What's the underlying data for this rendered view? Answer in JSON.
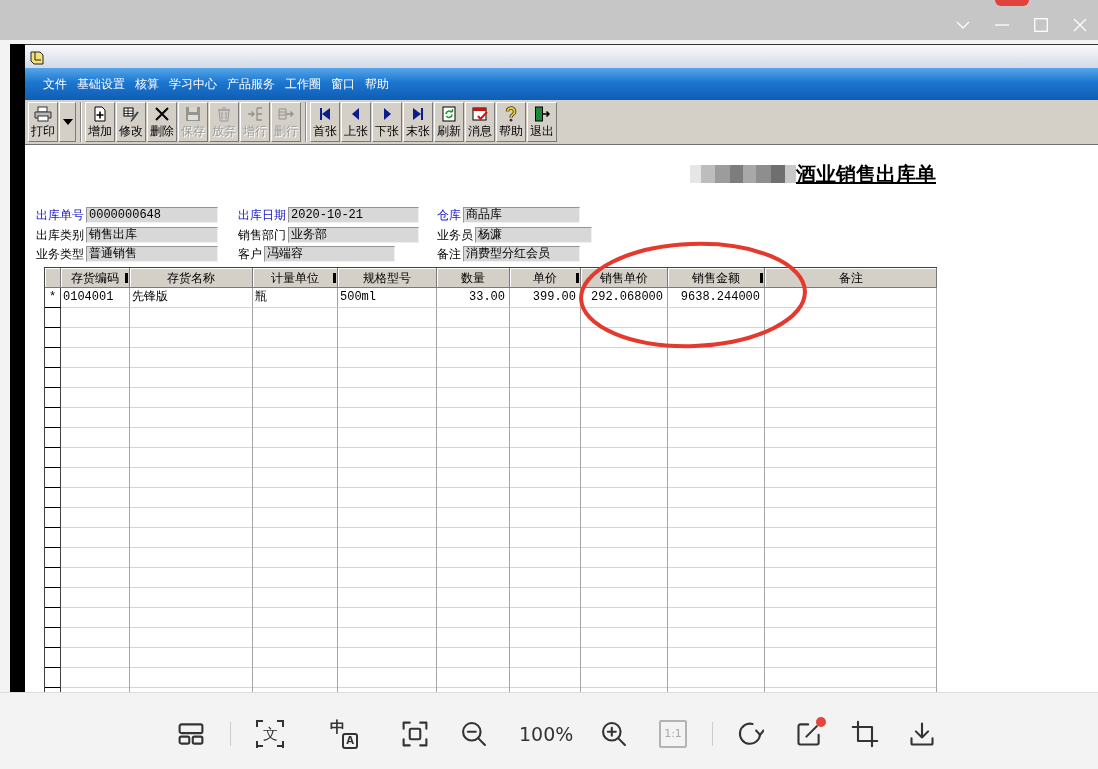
{
  "app": {
    "menu": [
      "文件",
      "基础设置",
      "核算",
      "学习中心",
      "产品服务",
      "工作圈",
      "窗口",
      "帮助"
    ],
    "toolbar": [
      [
        {
          "kind": "button",
          "label": "打印",
          "disabled": false
        },
        {
          "kind": "dropdown",
          "disabled": false
        }
      ],
      [
        {
          "kind": "button",
          "label": "增加",
          "disabled": false
        },
        {
          "kind": "button",
          "label": "修改",
          "disabled": false
        },
        {
          "kind": "button",
          "label": "删除",
          "disabled": false
        },
        {
          "kind": "button",
          "label": "保存",
          "disabled": true
        },
        {
          "kind": "button",
          "label": "放弃",
          "disabled": true
        },
        {
          "kind": "button",
          "label": "增行",
          "disabled": true
        },
        {
          "kind": "button",
          "label": "删行",
          "disabled": true
        }
      ],
      [
        {
          "kind": "button",
          "label": "首张",
          "disabled": false
        },
        {
          "kind": "button",
          "label": "上张",
          "disabled": false
        },
        {
          "kind": "button",
          "label": "下张",
          "disabled": false
        },
        {
          "kind": "button",
          "label": "末张",
          "disabled": false
        },
        {
          "kind": "button",
          "label": "刷新",
          "disabled": false
        },
        {
          "kind": "button",
          "label": "消息",
          "disabled": false
        },
        {
          "kind": "button",
          "label": "帮助",
          "disabled": false
        },
        {
          "kind": "button",
          "label": "退出",
          "disabled": false
        }
      ]
    ]
  },
  "form": {
    "title": "酒业销售出库单",
    "fields": [
      [
        {
          "label": "出库单号",
          "value": "0000000648",
          "required": true
        },
        {
          "label": "出库日期",
          "value": "2020-10-21",
          "required": true
        },
        {
          "label": "仓库",
          "value": "商品库",
          "required": true
        }
      ],
      [
        {
          "label": "出库类别",
          "value": "销售出库",
          "required": false
        },
        {
          "label": "销售部门",
          "value": "业务部",
          "required": false
        },
        {
          "label": "业务员",
          "value": "杨濂",
          "required": false
        }
      ],
      [
        {
          "label": "业务类型",
          "value": "普通销售",
          "required": false
        },
        {
          "label": "客户",
          "value": "冯端容",
          "required": false
        },
        {
          "label": "备注",
          "value": "消费型分红会员",
          "required": false
        }
      ]
    ]
  },
  "table": {
    "columns": [
      {
        "label": "存货编码",
        "kind": "text",
        "edge_mark": true
      },
      {
        "label": "存货名称",
        "kind": "text",
        "edge_mark": false
      },
      {
        "label": "计量单位",
        "kind": "text",
        "edge_mark": true
      },
      {
        "label": "规格型号",
        "kind": "text",
        "edge_mark": false
      },
      {
        "label": "数量",
        "kind": "number",
        "edge_mark": false
      },
      {
        "label": "单价",
        "kind": "number",
        "edge_mark": true
      },
      {
        "label": "销售单价",
        "kind": "number",
        "edge_mark": false
      },
      {
        "label": "销售金额",
        "kind": "number",
        "edge_mark": true
      },
      {
        "label": "备注",
        "kind": "text",
        "edge_mark": false
      }
    ],
    "rows": [
      {
        "indicator": "*",
        "cells": [
          "0104001",
          "先锋版",
          "瓶",
          "500ml",
          "33.00",
          "399.00",
          "292.068000",
          "9638.244000"
        ]
      }
    ]
  },
  "viewer_toolbar": {
    "ocr_glyph": "文",
    "translate_glyphs": [
      "中",
      "A"
    ],
    "zoom_level": "100%",
    "actual_size": {
      "label": "1:1",
      "disabled": true
    },
    "edit_badge": true
  }
}
